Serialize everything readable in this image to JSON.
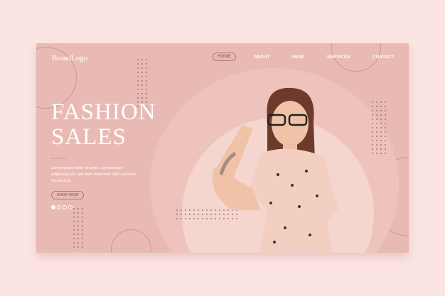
{
  "brand": {
    "logo": "BrandLogo"
  },
  "nav": {
    "items": [
      {
        "label": "HOME",
        "active": true
      },
      {
        "label": "ABOUT"
      },
      {
        "label": "SHOP"
      },
      {
        "label": "SERVICES"
      },
      {
        "label": "CONTACT"
      }
    ]
  },
  "hero": {
    "title_line1": "FASHION",
    "title_line2": "SALES",
    "dots": "••••••",
    "body": "Lorem ipsum dolor sit amet, consectetuer adipiscing elit, sed diam nonummy nibh euismod tincidunt ut.",
    "cta": "SHOP NOW",
    "slides": {
      "count": 4,
      "active": 1
    }
  },
  "colors": {
    "background": "#fbe4e2",
    "card": "#e9bab3",
    "disc": "#f2cdc6",
    "accent": "#a87d78"
  }
}
